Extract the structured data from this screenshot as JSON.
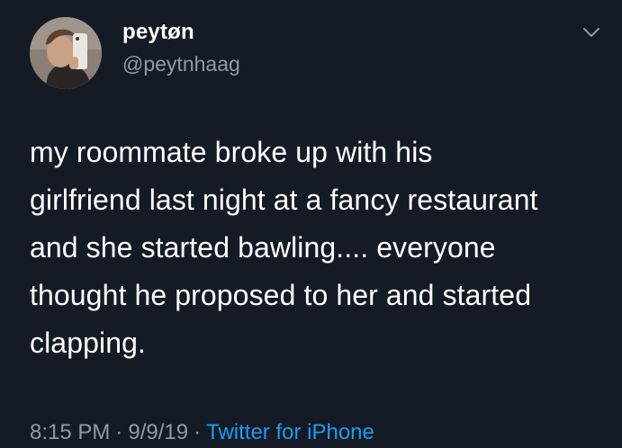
{
  "user": {
    "display_name": "peytøn",
    "handle": "@peytnhaag"
  },
  "tweet": {
    "lines": [
      "my roommate broke up with his",
      "girlfriend last night at a fancy restaurant",
      "and she started bawling.... everyone",
      "thought he proposed to her and started",
      "clapping."
    ]
  },
  "meta": {
    "time": "8:15 PM",
    "separator": "·",
    "date": "9/9/19",
    "source": "Twitter for iPhone"
  },
  "colors": {
    "background": "#151b25",
    "text": "#ffffff",
    "secondary": "#8e9aa7",
    "link": "#1c9bee"
  },
  "icons": {
    "menu": "chevron-down-icon"
  }
}
